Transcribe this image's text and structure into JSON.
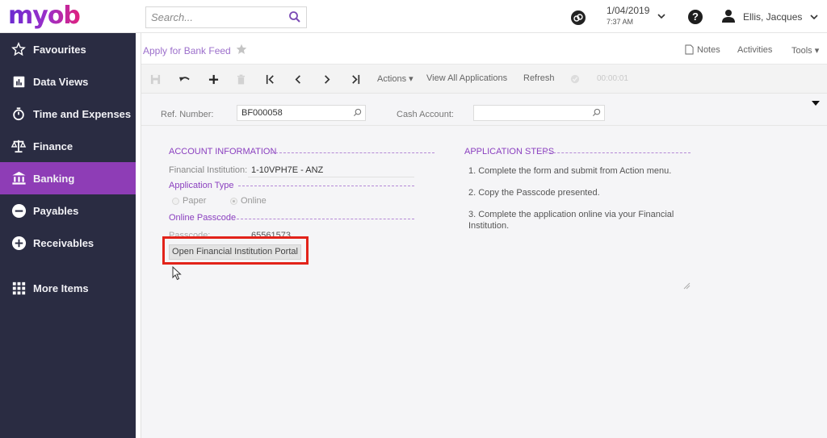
{
  "app": {
    "logo_text": "myob",
    "brand_gradient": [
      "#6b2bd0",
      "#e0217d"
    ]
  },
  "topbar": {
    "search_placeholder": "Search...",
    "date": "1/04/2019",
    "time": "7:37 AM",
    "help_glyph": "?",
    "user_name": "Ellis, Jacques"
  },
  "sidebar": {
    "active_color": "#8e3db6",
    "items": [
      {
        "label": "Favourites",
        "icon": "star-icon"
      },
      {
        "label": "Data Views",
        "icon": "chart-icon"
      },
      {
        "label": "Time and Expenses",
        "icon": "stopwatch-icon"
      },
      {
        "label": "Finance",
        "icon": "scales-icon"
      },
      {
        "label": "Banking",
        "icon": "bank-icon",
        "active": true
      },
      {
        "label": "Payables",
        "icon": "minus-circle-icon"
      },
      {
        "label": "Receivables",
        "icon": "plus-circle-icon"
      },
      {
        "label": "More Items",
        "icon": "grid-icon"
      }
    ]
  },
  "page": {
    "title": "Apply for Bank Feed",
    "notes_label": "Notes",
    "activities_label": "Activities",
    "tools_label": "Tools ▾"
  },
  "toolbar": {
    "actions_label": "Actions ▾",
    "view_all_label": "View All Applications",
    "refresh_label": "Refresh",
    "timer": "00:00:01"
  },
  "filters": {
    "ref_label": "Ref. Number:",
    "ref_value": "BF000058",
    "cash_label": "Cash Account:",
    "cash_value": ""
  },
  "account_info": {
    "section_title": "ACCOUNT INFORMATION",
    "fi_label": "Financial Institution:",
    "fi_value": "1-10VPH7E - ANZ",
    "app_type_title": "Application Type",
    "radio_paper": "Paper",
    "radio_online": "Online",
    "selected_type": "Online",
    "passcode_title": "Online Passcode",
    "passcode_label": "Passcode:",
    "passcode_value": "65561573",
    "portal_button": "Open Financial Institution Portal"
  },
  "application_steps": {
    "section_title": "APPLICATION STEPS",
    "steps": [
      "1. Complete the form and submit from Action menu.",
      "2. Copy the Passcode presented.",
      "3. Complete the application online via your Financial Institution."
    ]
  },
  "annotation": {
    "highlight_color": "#e2231a"
  }
}
